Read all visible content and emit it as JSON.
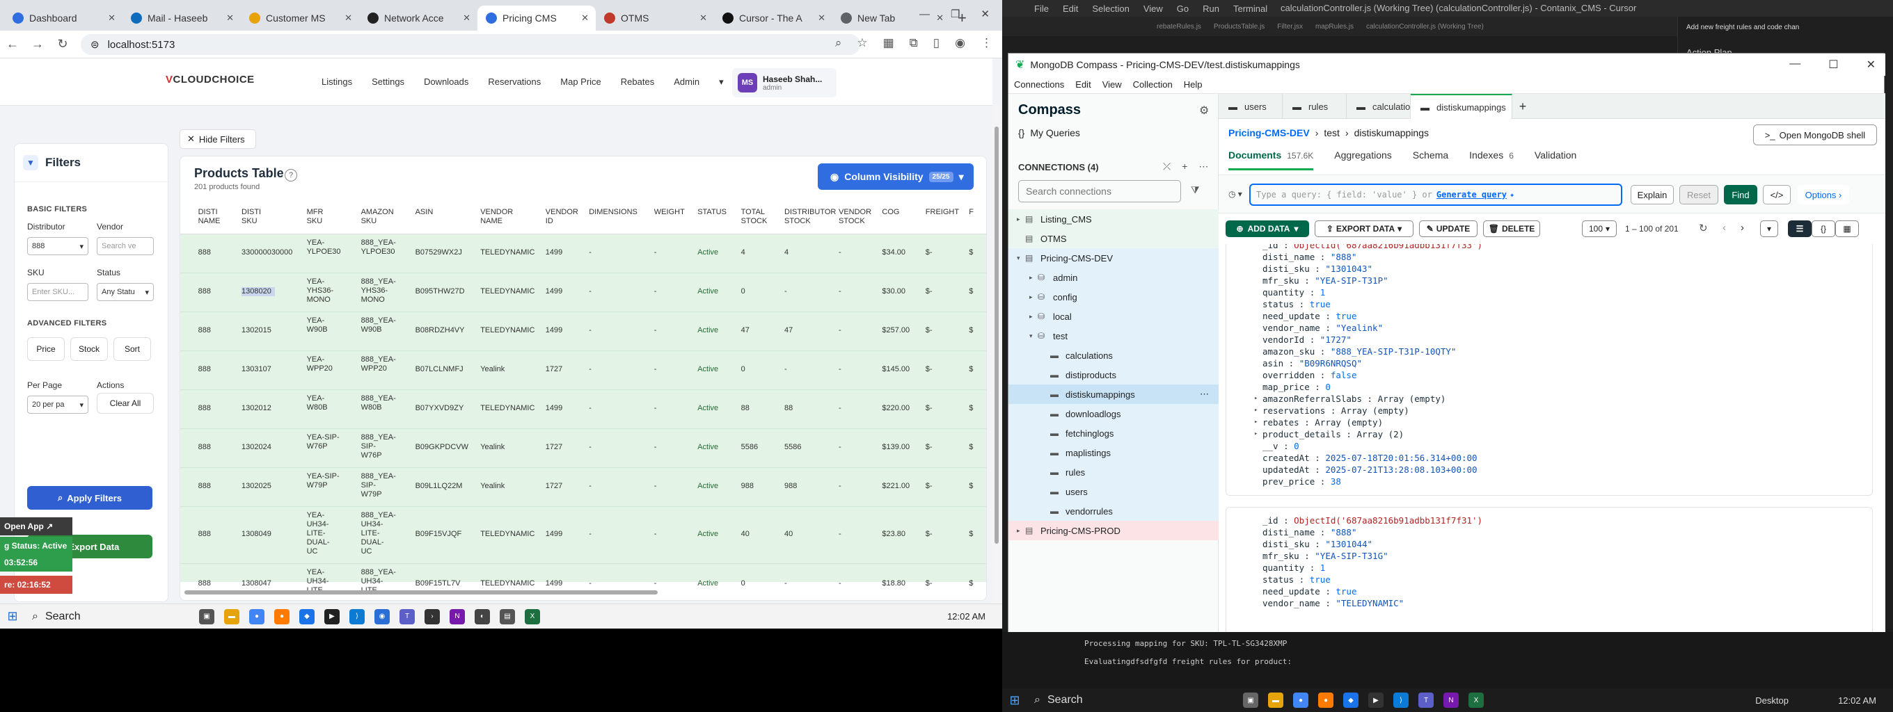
{
  "browser": {
    "tabs": [
      {
        "label": "Dashboard",
        "color": "#2f6de0"
      },
      {
        "label": "Mail - Haseeb",
        "color": "#0f6cbd"
      },
      {
        "label": "Customer MS",
        "color": "#e8a20c"
      },
      {
        "label": "Network Acce",
        "color": "#222222"
      },
      {
        "label": "Pricing CMS",
        "color": "#2f6de0",
        "active": true
      },
      {
        "label": "OTMS",
        "color": "#c0392b"
      },
      {
        "label": "Cursor - The A",
        "color": "#111111"
      },
      {
        "label": "New Tab",
        "color": "#5f6368"
      }
    ],
    "url": "localhost:5173"
  },
  "app": {
    "logo_a": "V",
    "logo_b": "CLOUDCHOICE",
    "menu": [
      "Listings",
      "Settings",
      "Downloads",
      "Reservations",
      "Map Price",
      "Rebates",
      "Admin"
    ],
    "user_initials": "MS",
    "user_name": "Haseeb Shah...",
    "user_role": "admin"
  },
  "filters": {
    "title": "Filters",
    "basic": "BASIC FILTERS",
    "distributor_label": "Distributor",
    "distributor_value": "888",
    "vendor_label": "Vendor",
    "vendor_placeholder": "Search ve",
    "sku_label": "SKU",
    "sku_placeholder": "Enter SKU...",
    "status_label": "Status",
    "status_value": "Any Statu",
    "advanced": "ADVANCED FILTERS",
    "price": "Price",
    "stock": "Stock",
    "sort": "Sort",
    "per_page_label": "Per Page",
    "per_page_value": "20 per pa",
    "actions_label": "Actions",
    "clear_all": "Clear All",
    "apply": "Apply Filters",
    "export": "Export Data"
  },
  "hide_filters": "Hide Filters",
  "products": {
    "title": "Products Table",
    "subtitle": "201 products found",
    "colvis_label": "Column Visibility",
    "colvis_badge": "25/25",
    "headers": [
      "DISTI NAME",
      "DISTI SKU",
      "MFR SKU",
      "AMAZON SKU",
      "ASIN",
      "VENDOR NAME",
      "VENDOR ID",
      "DIMENSIONS",
      "WEIGHT",
      "STATUS",
      "TOTAL STOCK",
      "DISTRIBUTOR STOCK",
      "VENDOR STOCK",
      "COG",
      "FREIGHT",
      "F"
    ],
    "rows": [
      [
        "888",
        "330000030000",
        "YEA-YLPOE30",
        "888_YEA-YLPOE30",
        "B07529WX2J",
        "TELEDYNAMIC",
        "1499",
        "-",
        "-",
        "Active",
        "4",
        "4",
        "-",
        "$34.00",
        "$-",
        "$"
      ],
      [
        "888",
        "1308020",
        "YEA-YHS36-MONO",
        "888_YEA-YHS36-MONO",
        "B095THW27D",
        "TELEDYNAMIC",
        "1499",
        "-",
        "-",
        "Active",
        "0",
        "-",
        "-",
        "$30.00",
        "$-",
        "$"
      ],
      [
        "888",
        "1302015",
        "YEA-W90B",
        "888_YEA-W90B",
        "B08RDZH4VY",
        "TELEDYNAMIC",
        "1499",
        "-",
        "-",
        "Active",
        "47",
        "47",
        "-",
        "$257.00",
        "$-",
        "$"
      ],
      [
        "888",
        "1303107",
        "YEA-WPP20",
        "888_YEA-WPP20",
        "B07LCLNMFJ",
        "Yealink",
        "1727",
        "-",
        "-",
        "Active",
        "0",
        "-",
        "-",
        "$145.00",
        "$-",
        "$"
      ],
      [
        "888",
        "1302012",
        "YEA-W80B",
        "888_YEA-W80B",
        "B07YXVD9ZY",
        "TELEDYNAMIC",
        "1499",
        "-",
        "-",
        "Active",
        "88",
        "88",
        "-",
        "$220.00",
        "$-",
        "$"
      ],
      [
        "888",
        "1302024",
        "YEA-SIP-W76P",
        "888_YEA-SIP-W76P",
        "B09GKPDCVW",
        "Yealink",
        "1727",
        "-",
        "-",
        "Active",
        "5586",
        "5586",
        "-",
        "$139.00",
        "$-",
        "$"
      ],
      [
        "888",
        "1302025",
        "YEA-SIP-W79P",
        "888_YEA-SIP-W79P",
        "B09L1LQ22M",
        "Yealink",
        "1727",
        "-",
        "-",
        "Active",
        "988",
        "988",
        "-",
        "$221.00",
        "$-",
        "$"
      ],
      [
        "888",
        "1308049",
        "YEA-UH34-LITE-DUAL-UC",
        "888_YEA-UH34-LITE-DUAL-UC",
        "B09F15VJQF",
        "TELEDYNAMIC",
        "1499",
        "-",
        "-",
        "Active",
        "40",
        "40",
        "-",
        "$23.80",
        "$-",
        "$"
      ],
      [
        "888",
        "1308047",
        "YEA-UH34-LITE",
        "888_YEA-UH34-LITE",
        "B09F15TL7V",
        "TELEDYNAMIC",
        "1499",
        "-",
        "-",
        "Active",
        "0",
        "-",
        "-",
        "$18.80",
        "$-",
        "$"
      ]
    ]
  },
  "overlay": {
    "open_app": "Open App",
    "status": "g Status: Active",
    "time1": "03:52:56",
    "time2": "re: 02:16:52"
  },
  "taskbar": {
    "search": "Search",
    "time": "12:02 AM"
  },
  "cursor": {
    "menu": [
      "File",
      "Edit",
      "Selection",
      "View",
      "Go",
      "Run",
      "Terminal"
    ],
    "title": "calculationController.js (Working Tree) (calculationController.js) - Contanix_CMS - Cursor",
    "tabs": [
      "rebateRules.js",
      "ProductsTable.js",
      "Filter.jsx",
      "mapRules.js",
      "calculationController.js (Working Tree)"
    ],
    "right_title": "Add new freight rules and code chan",
    "right_sub": "Action Plan",
    "terminal_1": "Processing mapping for SKU: TPL-TL-SG3428XMP",
    "terminal_2": "Evaluatingdfsdfgfd freight rules for product:"
  },
  "compass": {
    "window_title": "MongoDB Compass - Pricing-CMS-DEV/test.distiskumappings",
    "menu": [
      "Connections",
      "Edit",
      "View",
      "Collection",
      "Help"
    ],
    "brand": "Compass",
    "my_queries": "My Queries",
    "connections_label": "CONNECTIONS (4)",
    "search_placeholder": "Search connections",
    "tree": [
      {
        "label": "Listing_CMS",
        "level": 0,
        "arrow": "▸",
        "icon": "▤",
        "bg": "#eaf6ef"
      },
      {
        "label": "OTMS",
        "level": 0,
        "arrow": "",
        "icon": "▤",
        "bg": "#eaf6ef"
      },
      {
        "label": "Pricing-CMS-DEV",
        "level": 0,
        "arrow": "▾",
        "icon": "▤",
        "bg": "#e3f1fb"
      },
      {
        "label": "admin",
        "level": 1,
        "arrow": "▸",
        "icon": "⛁",
        "bg": "#e3f1fb"
      },
      {
        "label": "config",
        "level": 1,
        "arrow": "▸",
        "icon": "⛁",
        "bg": "#e3f1fb"
      },
      {
        "label": "local",
        "level": 1,
        "arrow": "▸",
        "icon": "⛁",
        "bg": "#e3f1fb"
      },
      {
        "label": "test",
        "level": 1,
        "arrow": "▾",
        "icon": "⛁",
        "bg": "#e3f1fb"
      },
      {
        "label": "calculations",
        "level": 2,
        "arrow": "",
        "icon": "▬",
        "bg": "#e3f1fb"
      },
      {
        "label": "distiproducts",
        "level": 2,
        "arrow": "",
        "icon": "▬",
        "bg": "#e3f1fb"
      },
      {
        "label": "distiskumappings",
        "level": 2,
        "arrow": "",
        "icon": "▬",
        "bg": "#c9e3f6",
        "active": true
      },
      {
        "label": "downloadlogs",
        "level": 2,
        "arrow": "",
        "icon": "▬",
        "bg": "#e3f1fb"
      },
      {
        "label": "fetchinglogs",
        "level": 2,
        "arrow": "",
        "icon": "▬",
        "bg": "#e3f1fb"
      },
      {
        "label": "maplistings",
        "level": 2,
        "arrow": "",
        "icon": "▬",
        "bg": "#e3f1fb"
      },
      {
        "label": "rules",
        "level": 2,
        "arrow": "",
        "icon": "▬",
        "bg": "#e3f1fb"
      },
      {
        "label": "users",
        "level": 2,
        "arrow": "",
        "icon": "▬",
        "bg": "#e3f1fb"
      },
      {
        "label": "vendorrules",
        "level": 2,
        "arrow": "",
        "icon": "▬",
        "bg": "#e3f1fb"
      },
      {
        "label": "Pricing-CMS-PROD",
        "level": 0,
        "arrow": "▸",
        "icon": "▤",
        "bg": "#fbe3e6"
      }
    ],
    "tabs": [
      "users",
      "rules",
      "calculations",
      "distiskumappings"
    ],
    "breadcrumb": [
      "Pricing-CMS-DEV",
      "test",
      "distiskumappings"
    ],
    "open_shell": "Open MongoDB shell",
    "subtabs": [
      {
        "label": "Documents",
        "count": "157.6K"
      },
      {
        "label": "Aggregations",
        "count": ""
      },
      {
        "label": "Schema",
        "count": ""
      },
      {
        "label": "Indexes",
        "count": "6"
      },
      {
        "label": "Validation",
        "count": ""
      }
    ],
    "query_placeholder": "Type a query: { field: 'value' } or",
    "generate_query": "Generate query",
    "explain": "Explain",
    "reset": "Reset",
    "find": "Find",
    "options": "Options",
    "add_data": "ADD DATA",
    "export_data": "EXPORT DATA",
    "update": "UPDATE",
    "delete": "DELETE",
    "page_size": "100",
    "range": "1 – 100 of 201",
    "doc1": [
      {
        "k": "_id",
        "v": "ObjectId('687aa8216b91adbb131f7f33')",
        "t": "o"
      },
      {
        "k": "disti_name",
        "v": "\"888\"",
        "t": "s"
      },
      {
        "k": "disti_sku",
        "v": "\"1301043\"",
        "t": "s"
      },
      {
        "k": "mfr_sku",
        "v": "\"YEA-SIP-T31P\"",
        "t": "s"
      },
      {
        "k": "quantity",
        "v": "1",
        "t": "n"
      },
      {
        "k": "status",
        "v": "true",
        "t": "b"
      },
      {
        "k": "need_update",
        "v": "true",
        "t": "b"
      },
      {
        "k": "vendor_name",
        "v": "\"Yealink\"",
        "t": "s"
      },
      {
        "k": "vendorId",
        "v": "\"1727\"",
        "t": "s"
      },
      {
        "k": "amazon_sku",
        "v": "\"888_YEA-SIP-T31P-10QTY\"",
        "t": "s"
      },
      {
        "k": "asin",
        "v": "\"B09R6NRQSQ\"",
        "t": "s"
      },
      {
        "k": "overridden",
        "v": "false",
        "t": "b"
      },
      {
        "k": "map_price",
        "v": "0",
        "t": "n"
      },
      {
        "k": "amazonReferralSlabs",
        "v": "Array (empty)",
        "t": "a",
        "arrow": true
      },
      {
        "k": "reservations",
        "v": "Array (empty)",
        "t": "a",
        "arrow": true
      },
      {
        "k": "rebates",
        "v": "Array (empty)",
        "t": "a",
        "arrow": true
      },
      {
        "k": "product_details",
        "v": "Array (2)",
        "t": "a",
        "arrow": true
      },
      {
        "k": "__v",
        "v": "0",
        "t": "n"
      },
      {
        "k": "createdAt",
        "v": "2025-07-18T20:01:56.314+00:00",
        "t": "s"
      },
      {
        "k": "updatedAt",
        "v": "2025-07-21T13:28:08.103+00:00",
        "t": "s"
      },
      {
        "k": "prev_price",
        "v": "38",
        "t": "n"
      }
    ],
    "doc2": [
      {
        "k": "_id",
        "v": "ObjectId('687aa8216b91adbb131f7f31')",
        "t": "o"
      },
      {
        "k": "disti_name",
        "v": "\"888\"",
        "t": "s"
      },
      {
        "k": "disti_sku",
        "v": "\"1301044\"",
        "t": "s"
      },
      {
        "k": "mfr_sku",
        "v": "\"YEA-SIP-T31G\"",
        "t": "s"
      },
      {
        "k": "quantity",
        "v": "1",
        "t": "n"
      },
      {
        "k": "status",
        "v": "true",
        "t": "b"
      },
      {
        "k": "need_update",
        "v": "true",
        "t": "b"
      },
      {
        "k": "vendor_name",
        "v": "\"TELEDYNAMIC\"",
        "t": "s"
      }
    ]
  },
  "taskbar2": {
    "search": "Search",
    "desktop": "Desktop",
    "time": "12:02 AM"
  }
}
